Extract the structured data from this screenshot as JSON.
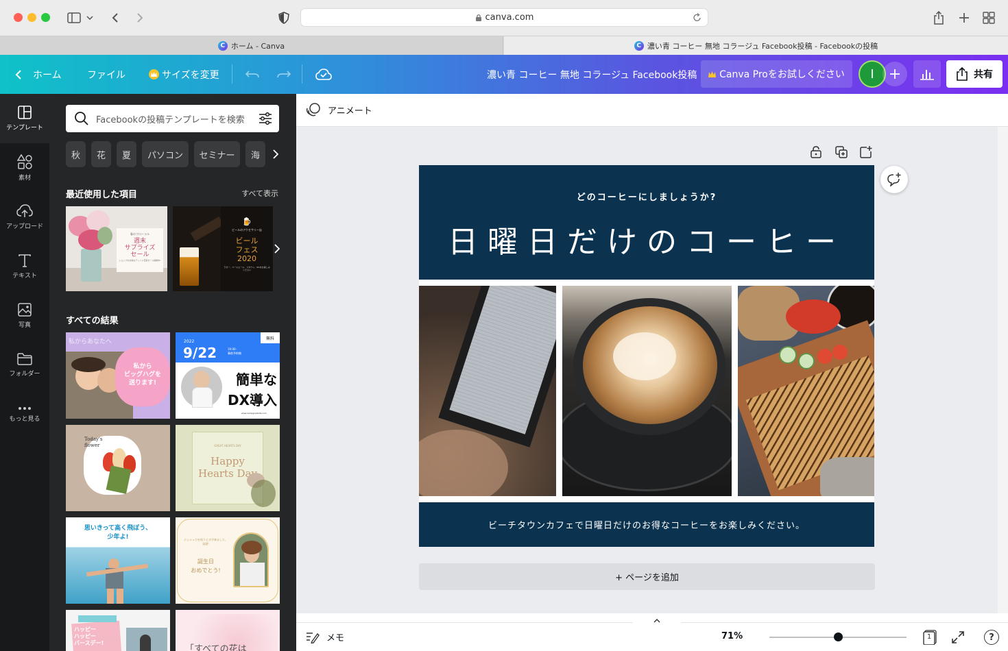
{
  "browser": {
    "url": "canva.com"
  },
  "tabs": [
    {
      "title": "ホーム - Canva"
    },
    {
      "title": "濃い青 コーヒー 無地 コラージュ Facebook投稿 - Facebookの投稿"
    }
  ],
  "toolbar": {
    "home": "ホーム",
    "file": "ファイル",
    "resize": "サイズを変更",
    "doc_title": "濃い青 コーヒー 無地 コラージュ Facebook投稿",
    "pro": "Canva Proをお試しください",
    "avatar_initial": "I",
    "share": "共有"
  },
  "rail": [
    {
      "label": "テンプレート",
      "icon": "template-icon"
    },
    {
      "label": "素材",
      "icon": "elements-icon"
    },
    {
      "label": "アップロード",
      "icon": "upload-icon"
    },
    {
      "label": "テキスト",
      "icon": "text-icon"
    },
    {
      "label": "写真",
      "icon": "photo-icon"
    },
    {
      "label": "フォルダー",
      "icon": "folder-icon"
    },
    {
      "label": "もっと見る",
      "icon": "more-icon"
    }
  ],
  "panel": {
    "search_placeholder": "Facebookの投稿テンプレートを検索",
    "chips": [
      "秋",
      "花",
      "夏",
      "パソコン",
      "セミナー",
      "海"
    ],
    "recent_title": "最近使用した項目",
    "see_all": "すべて表示",
    "all_results": "すべての結果",
    "recent": [
      {
        "small": "春のフローラル",
        "text": "週末\nサプライズ\nセール",
        "sub": "ショップのお得なアレンジ花束セール開催中!"
      },
      {
        "small": "ビールのアクセサリー店",
        "text": "ビール\nフェス\n2020",
        "sub": "ラガー、ペールエール、スタウト、IPAをお楽しみください"
      }
    ],
    "results": {
      "r1": {
        "faint": "私からあなたへ",
        "text": "私から\nビッグハグを\n送ります!"
      },
      "r2": {
        "badge": "無料",
        "year": "2022",
        "date": "9/22",
        "time": "19:00-\n事前予約制",
        "title": "簡単な\nDX導入",
        "url": "www.reallygreatsite.com"
      },
      "r3": {
        "text": "Today's\nflower"
      },
      "r4": {
        "small": "GREAT HEARTS DAY",
        "title": "Happy\nHearts Day"
      },
      "r5": {
        "text": "思いきって高く飛ぼう、\n少年よ!"
      },
      "r6": {
        "small": "ジェシュカを祝うときが来ました、笑顔!",
        "text": "誕生日\nおめでとう!"
      },
      "r7": {
        "text": "ハッピー\nハッピー\nバースデー!"
      },
      "r8": {
        "text": "「すべての花は"
      }
    }
  },
  "editor": {
    "animate": "アニメート",
    "add_page": "+ ページを追加",
    "notes": "メモ",
    "zoom": "71%",
    "page_number": "1"
  },
  "design": {
    "subtitle": "どのコーヒーにしましょうか?",
    "title": "日曜日だけのコーヒー",
    "footer": "ビーチタウンカフェで日曜日だけのお得なコーヒーをお楽しみください。",
    "navy": "#0b3350"
  },
  "zoom_fraction": 0.71
}
